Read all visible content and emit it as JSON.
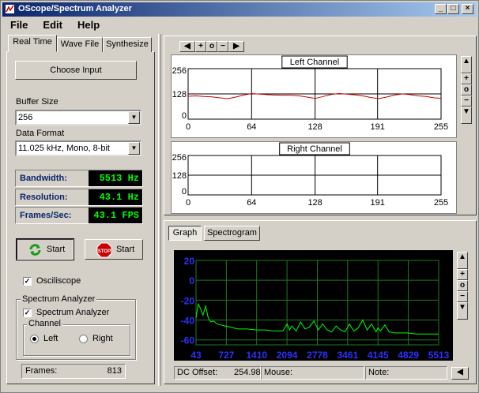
{
  "window": {
    "title": "OScope/Spectrum Analyzer",
    "controls": [
      "_",
      "□",
      "×"
    ]
  },
  "menu": [
    "File",
    "Edit",
    "Help"
  ],
  "left_tabs": [
    "Real Time",
    "Wave File",
    "Synthesize"
  ],
  "left_panel": {
    "choose_input": "Choose Input",
    "buffer_size_label": "Buffer Size",
    "buffer_size_value": "256",
    "data_format_label": "Data Format",
    "data_format_value": "11.025 kHz, Mono, 8-bit",
    "metrics": [
      {
        "name": "Bandwidth:",
        "value": "5513 Hz"
      },
      {
        "name": "Resolution:",
        "value": "43.1 Hz"
      },
      {
        "name": "Frames/Sec:",
        "value": "43.1 FPS"
      }
    ],
    "start_green": "Start",
    "start_stop": "Start",
    "stop_sign": "STOP",
    "oscilloscope_label": "Osciliscope",
    "oscilloscope_checked": true,
    "spectrum_group_title": "Spectrum Analyzer",
    "spectrum_check_label": "Spectrum Analyzer",
    "spectrum_checked": true,
    "channel_group_title": "Channel",
    "channel_left": "Left",
    "channel_right": "Right",
    "channel_selected": "Left",
    "frames_label": "Frames:",
    "frames_value": "813"
  },
  "scope_toolbar_icons": [
    "shrink-left-icon",
    "plus-icon",
    "circle-icon",
    "minus-icon",
    "expand-right-icon"
  ],
  "side_toolbar_icons": [
    "up-arrow-icon",
    "plus-icon",
    "circle-icon",
    "minus-icon",
    "down-arrow-icon"
  ],
  "chart_data": [
    {
      "type": "line",
      "title": "Left Channel",
      "yticks": [
        "256",
        "128",
        "0"
      ],
      "xticks": [
        "0",
        "64",
        "128",
        "191",
        "255"
      ],
      "xlim": [
        0,
        255
      ],
      "ylim": [
        0,
        256
      ],
      "color": "#cc0000",
      "series": [
        {
          "x": [
            0,
            8,
            16,
            24,
            32,
            40,
            48,
            56,
            64,
            72,
            80,
            88,
            96,
            104,
            112,
            120,
            128,
            136,
            144,
            152,
            160,
            168,
            176,
            184,
            192,
            200,
            208,
            216,
            224,
            232,
            240,
            248,
            255
          ],
          "values": [
            116,
            118,
            115,
            113,
            108,
            104,
            112,
            122,
            130,
            127,
            124,
            122,
            121,
            121,
            118,
            112,
            105,
            115,
            125,
            130,
            127,
            123,
            118,
            110,
            104,
            112,
            122,
            128,
            124,
            118,
            115,
            108,
            106
          ]
        }
      ]
    },
    {
      "type": "line",
      "title": "Right Channel",
      "yticks": [
        "256",
        "128",
        "0"
      ],
      "xticks": [
        "0",
        "64",
        "128",
        "191",
        "255"
      ],
      "xlim": [
        0,
        255
      ],
      "ylim": [
        0,
        256
      ],
      "series": []
    },
    {
      "type": "line",
      "yticks": [
        "20",
        "0",
        "-20",
        "-40",
        "-60"
      ],
      "xticks": [
        "43",
        "727",
        "1410",
        "2094",
        "2778",
        "3461",
        "4145",
        "4829",
        "5513"
      ],
      "xlim": [
        43,
        5513
      ],
      "ylim": [
        -65,
        20
      ],
      "color": "#00ff00",
      "series": [
        {
          "x": [
            43,
            90,
            140,
            200,
            260,
            320,
            380,
            440,
            520,
            600,
            700,
            800,
            900,
            1000,
            1200,
            1400,
            1600,
            1800,
            2000,
            2100,
            2150,
            2200,
            2300,
            2400,
            2500,
            2600,
            2700,
            2800,
            2900,
            3000,
            3100,
            3200,
            3300,
            3400,
            3500,
            3600,
            3700,
            3800,
            3900,
            4000,
            4100,
            4145,
            4200,
            4300,
            4400,
            4500,
            4600,
            4800,
            5000,
            5200,
            5513
          ],
          "values": [
            -38,
            -24,
            -28,
            -35,
            -26,
            -38,
            -42,
            -41,
            -44,
            -45,
            -46,
            -47,
            -48,
            -49,
            -49,
            -50,
            -50,
            -51,
            -51,
            -44,
            -50,
            -46,
            -51,
            -42,
            -49,
            -47,
            -41,
            -50,
            -44,
            -50,
            -52,
            -46,
            -50,
            -52,
            -44,
            -51,
            -48,
            -40,
            -50,
            -44,
            -52,
            -48,
            -51,
            -45,
            -52,
            -53,
            -53,
            -53,
            -54,
            -54,
            -54
          ]
        }
      ]
    }
  ],
  "scope_tabs": [
    "Graph",
    "Spectrogram"
  ],
  "status": {
    "dc_offset_label": "DC Offset:",
    "dc_offset_value": "254.98",
    "mouse_label": "Mouse:",
    "note_label": "Note:"
  }
}
